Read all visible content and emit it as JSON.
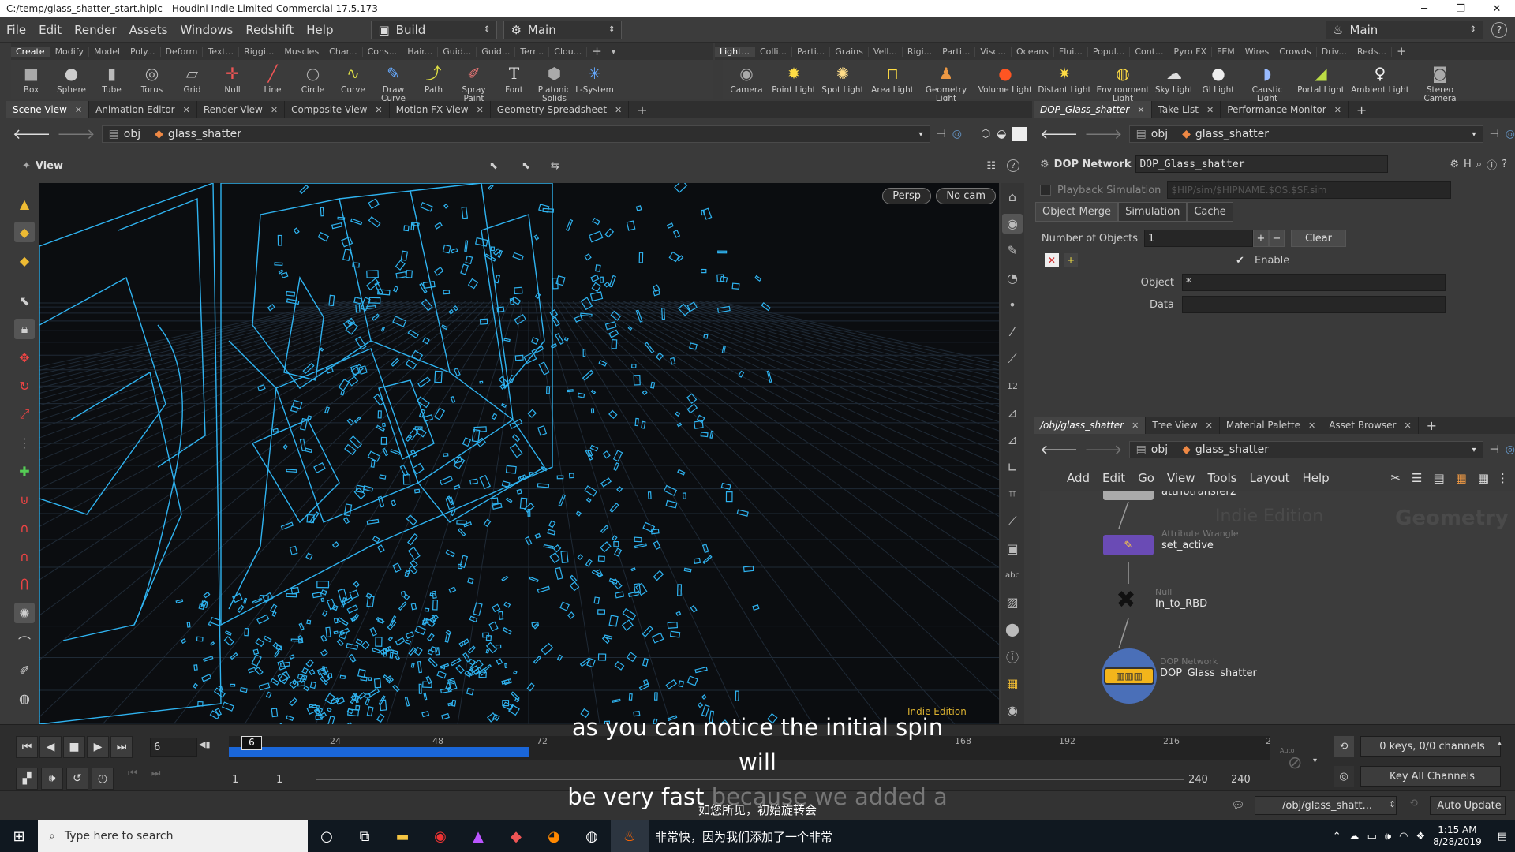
{
  "window": {
    "title": "C:/temp/glass_shatter_start.hiplc - Houdini Indie Limited-Commercial 17.5.173"
  },
  "menu": [
    "File",
    "Edit",
    "Render",
    "Assets",
    "Windows",
    "Redshift",
    "Help"
  ],
  "desktops": {
    "build": "Build",
    "main": "Main",
    "main_right": "Main"
  },
  "shelf_tabs_left": [
    "Create",
    "Modify",
    "Model",
    "Poly...",
    "Deform",
    "Text...",
    "Riggi...",
    "Muscles",
    "Char...",
    "Cons...",
    "Hair...",
    "Guid...",
    "Guid...",
    "Terr...",
    "Clou..."
  ],
  "shelf_tabs_right": [
    "Light...",
    "Colli...",
    "Parti...",
    "Grains",
    "Vell...",
    "Rigi...",
    "Parti...",
    "Visc...",
    "Oceans",
    "Flui...",
    "Popul...",
    "Cont...",
    "Pyro FX",
    "FEM",
    "Wires",
    "Crowds",
    "Driv...",
    "Reds..."
  ],
  "tools_left": [
    {
      "label": "Box",
      "icon": "box-icon"
    },
    {
      "label": "Sphere",
      "icon": "sphere-icon"
    },
    {
      "label": "Tube",
      "icon": "tube-icon"
    },
    {
      "label": "Torus",
      "icon": "torus-icon"
    },
    {
      "label": "Grid",
      "icon": "grid-icon"
    },
    {
      "label": "Null",
      "icon": "null-icon"
    },
    {
      "label": "Line",
      "icon": "line-icon"
    },
    {
      "label": "Circle",
      "icon": "circle-icon"
    },
    {
      "label": "Curve",
      "icon": "curve-icon"
    },
    {
      "label": "Draw Curve",
      "icon": "draw-curve-icon"
    },
    {
      "label": "Path",
      "icon": "path-icon"
    },
    {
      "label": "Spray Paint",
      "icon": "spray-paint-icon"
    },
    {
      "label": "Font",
      "icon": "font-icon"
    },
    {
      "label": "Platonic Solids",
      "icon": "platonic-icon"
    },
    {
      "label": "L-System",
      "icon": "lsystem-icon"
    }
  ],
  "tools_right": [
    {
      "label": "Camera",
      "icon": "camera-icon"
    },
    {
      "label": "Point Light",
      "icon": "point-light-icon"
    },
    {
      "label": "Spot Light",
      "icon": "spot-light-icon"
    },
    {
      "label": "Area Light",
      "icon": "area-light-icon"
    },
    {
      "label": "Geometry Light",
      "icon": "geometry-light-icon"
    },
    {
      "label": "Volume Light",
      "icon": "volume-light-icon"
    },
    {
      "label": "Distant Light",
      "icon": "distant-light-icon"
    },
    {
      "label": "Environment Light",
      "icon": "environment-light-icon"
    },
    {
      "label": "Sky Light",
      "icon": "sky-light-icon"
    },
    {
      "label": "GI Light",
      "icon": "gi-light-icon"
    },
    {
      "label": "Caustic Light",
      "icon": "caustic-light-icon"
    },
    {
      "label": "Portal Light",
      "icon": "portal-light-icon"
    },
    {
      "label": "Ambient Light",
      "icon": "ambient-light-icon"
    },
    {
      "label": "Stereo Camera",
      "icon": "stereo-camera-icon"
    }
  ],
  "left_tabs": [
    "Scene View",
    "Animation Editor",
    "Render View",
    "Composite View",
    "Motion FX View",
    "Geometry Spreadsheet"
  ],
  "path": {
    "root": "obj",
    "node": "glass_shatter"
  },
  "viewport": {
    "title": "View",
    "persp": "Persp",
    "cam": "No cam",
    "watermark": "Indie Edition"
  },
  "right_top_tabs": [
    "DOP_Glass_shatter",
    "Take List",
    "Performance Monitor"
  ],
  "params": {
    "type": "DOP Network",
    "name": "DOP_Glass_shatter",
    "playback": "Playback Simulation",
    "playback_path": "$HIP/sim/$HIPNAME.$OS.$SF.sim",
    "tabs": [
      "Object Merge",
      "Simulation",
      "Cache"
    ],
    "num_objects_label": "Number of Objects",
    "num_objects": "1",
    "clear": "Clear",
    "enable": "Enable",
    "object_label": "Object",
    "object_value": "*",
    "data_label": "Data",
    "data_value": ""
  },
  "right_bottom_tabs": [
    "/obj/glass_shatter",
    "Tree View",
    "Material Palette",
    "Asset Browser"
  ],
  "net_menu": [
    "Add",
    "Edit",
    "Go",
    "View",
    "Tools",
    "Layout",
    "Help"
  ],
  "network": {
    "watermark1": "Indie Edition",
    "watermark2": "Geometry",
    "nodes": [
      {
        "type": "",
        "name": "attribtransfer2"
      },
      {
        "type": "Attribute Wrangle",
        "name": "set_active"
      },
      {
        "type": "Null",
        "name": "In_to_RBD"
      },
      {
        "type": "DOP Network",
        "name": "DOP_Glass_shatter"
      }
    ]
  },
  "timeline": {
    "frame": "6",
    "current": "6",
    "ticks": [
      "24",
      "48",
      "72",
      "168",
      "192",
      "216",
      "2"
    ],
    "start": "1",
    "start2": "1",
    "end": "240",
    "end2": "240",
    "keys": "0 keys, 0/0 channels",
    "key_all": "Key All Channels",
    "auto_update": "Auto Update",
    "net_path": "/obj/glass_shatt...",
    "auto": "Auto"
  },
  "subtitles": {
    "line1": "as you can notice the initial spin will",
    "line2a": "be very fast",
    "line2b": "because we added a very",
    "cn1": "如您所见，初始旋转会",
    "cn2": "非常快，因为我们添加了一个非常"
  },
  "taskbar": {
    "search": "Type here to search",
    "time": "1:15 AM",
    "date": "8/28/2019"
  }
}
